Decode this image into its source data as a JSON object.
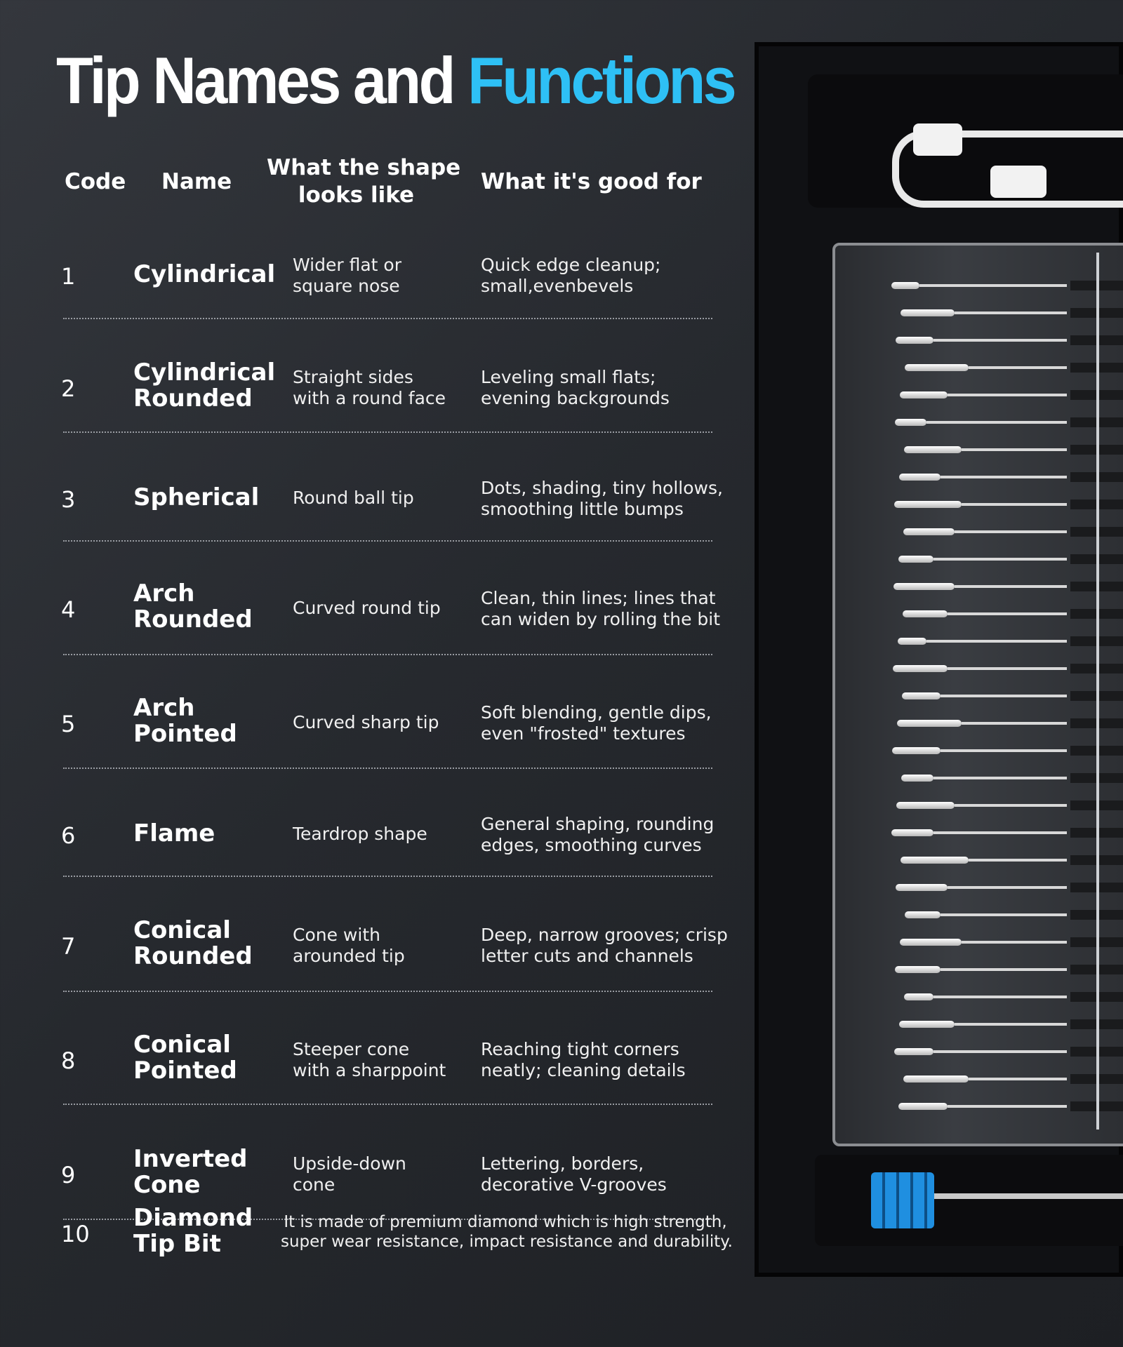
{
  "title": {
    "part1": "Tip Names and",
    "part2": "Functions"
  },
  "colors": {
    "accent": "#2ec0f5",
    "background": "#2a2d32"
  },
  "headers": {
    "code": "Code",
    "name": "Name",
    "shape_line1": "What the shape",
    "shape_line2": "looks like",
    "good": "What it's good for"
  },
  "rows": [
    {
      "code": "1",
      "name1": "Cylindrical",
      "name2": "",
      "shape1": "Wider flat or",
      "shape2": "square nose",
      "good1": "Quick edge cleanup;",
      "good2": "small,evenbevels"
    },
    {
      "code": "2",
      "name1": "Cylindrical",
      "name2": "Rounded",
      "shape1": "Straight sides",
      "shape2": "with a round face",
      "good1": "Leveling small flats;",
      "good2": "evening backgrounds"
    },
    {
      "code": "3",
      "name1": "Spherical",
      "name2": "",
      "shape1": "Round ball tip",
      "shape2": "",
      "good1": "Dots, shading, tiny hollows,",
      "good2": "smoothing little bumps"
    },
    {
      "code": "4",
      "name1": "Arch",
      "name2": "Rounded",
      "shape1": "Curved round tip",
      "shape2": "",
      "good1": "Clean, thin lines; lines that",
      "good2": "can widen by rolling the bit"
    },
    {
      "code": "5",
      "name1": "Arch",
      "name2": "Pointed",
      "shape1": "Curved sharp tip",
      "shape2": "",
      "good1": "Soft blending, gentle dips,",
      "good2": "even \"frosted\" textures"
    },
    {
      "code": "6",
      "name1": "Flame",
      "name2": "",
      "shape1": "Teardrop shape",
      "shape2": "",
      "good1": "General shaping, rounding",
      "good2": "edges, smoothing curves"
    },
    {
      "code": "7",
      "name1": "Conical",
      "name2": "Rounded",
      "shape1": "Cone with",
      "shape2": "arounded tip",
      "good1": "Deep, narrow grooves; crisp",
      "good2": "letter cuts and channels"
    },
    {
      "code": "8",
      "name1": "Conical",
      "name2": "Pointed",
      "shape1": "Steeper cone",
      "shape2": "with a sharppoint",
      "good1": "Reaching tight corners",
      "good2": "neatly; cleaning details"
    },
    {
      "code": "9",
      "name1": "Inverted",
      "name2": "Cone",
      "shape1": "Upside-down",
      "shape2": "cone",
      "good1": "Lettering, borders,",
      "good2": "decorative V-grooves"
    }
  ],
  "last_row": {
    "code": "10",
    "name1": "Diamond",
    "name2": "Tip Bit",
    "desc1": "It is made of premium diamond which is high strength,",
    "desc2": "super wear resistance, impact resistance and durability."
  }
}
